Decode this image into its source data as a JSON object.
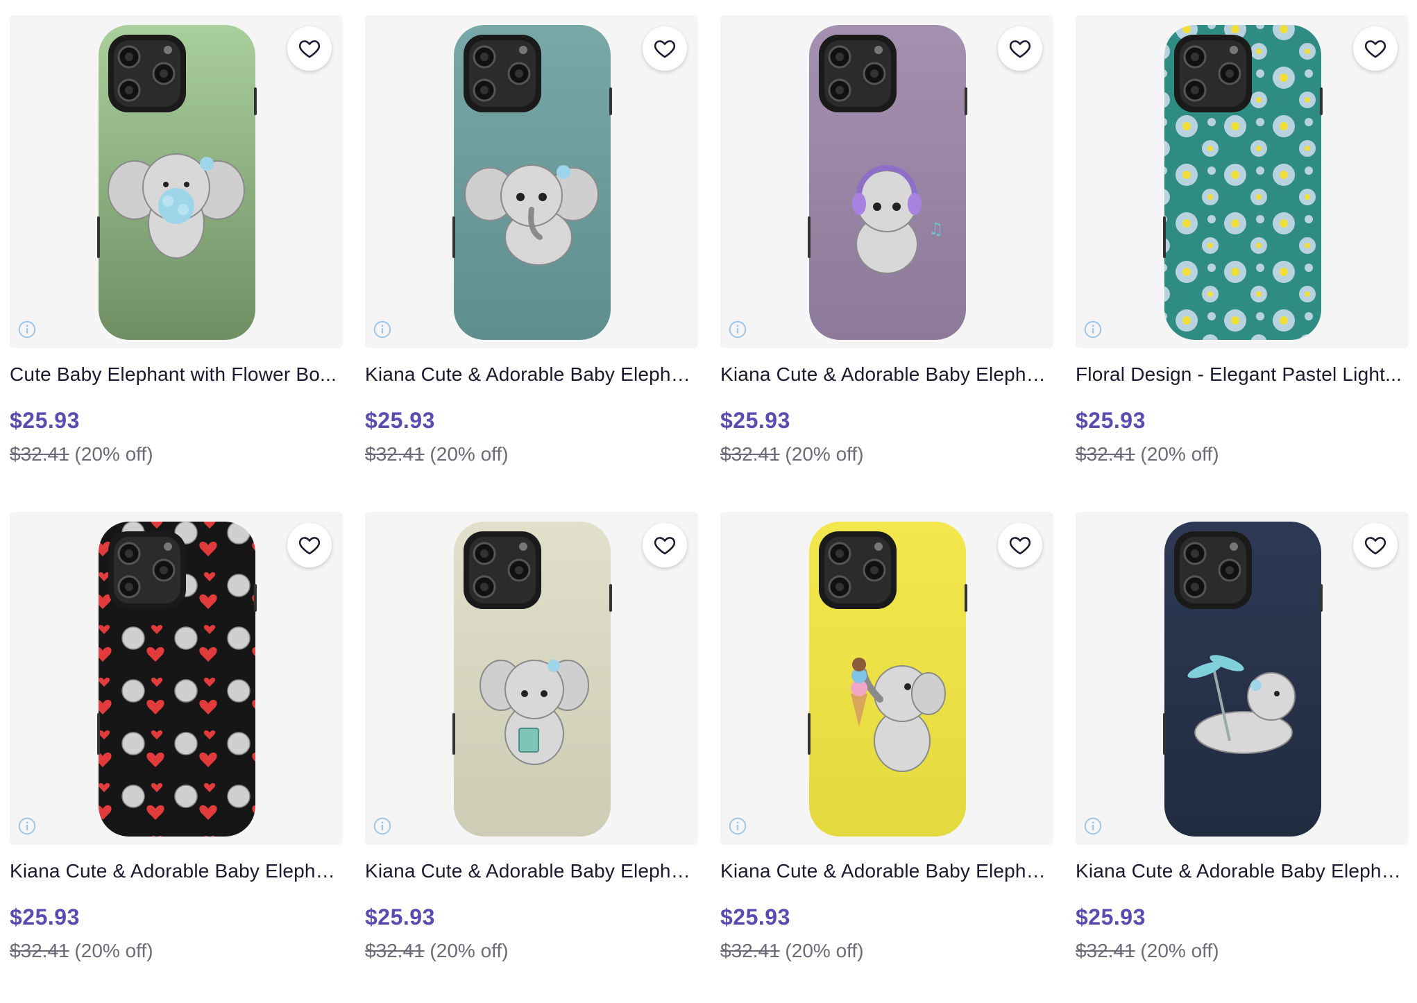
{
  "colors": {
    "price": "#5b4bb0",
    "title": "#1a1a2e",
    "muted": "#6b6b78",
    "card_bg": "#f5f5f6"
  },
  "products": [
    {
      "title": "Cute Baby Elephant with Flower Bo...",
      "price": "$25.93",
      "original_price": "$32.41",
      "discount": "(20% off)",
      "case_color": "#86a97a",
      "design": "elephant with flower bouquet",
      "favorite_icon": "heart-outline-icon",
      "info_icon": "info-icon"
    },
    {
      "title": "Kiana Cute & Adorable Baby Elepha...",
      "price": "$25.93",
      "original_price": "$32.41",
      "discount": "(20% off)",
      "case_color": "#6f9c9c",
      "design": "elephant walking",
      "favorite_icon": "heart-outline-icon",
      "info_icon": "info-icon"
    },
    {
      "title": "Kiana Cute & Adorable Baby Elepha...",
      "price": "$25.93",
      "original_price": "$32.41",
      "discount": "(20% off)",
      "case_color": "#9a84a6",
      "design": "elephant with headphones",
      "favorite_icon": "heart-outline-icon",
      "info_icon": "info-icon"
    },
    {
      "title": "Floral Design - Elegant Pastel Light...",
      "price": "$25.93",
      "original_price": "$32.41",
      "discount": "(20% off)",
      "case_color": "#2f8c82",
      "design": "pastel floral pattern",
      "favorite_icon": "heart-outline-icon",
      "info_icon": "info-icon"
    },
    {
      "title": "Kiana Cute & Adorable Baby Elepha...",
      "price": "$25.93",
      "original_price": "$32.41",
      "discount": "(20% off)",
      "case_color": "#161616",
      "design": "elephants and red hearts pattern",
      "favorite_icon": "heart-outline-icon",
      "info_icon": "info-icon"
    },
    {
      "title": "Kiana Cute & Adorable Baby Elepha...",
      "price": "$25.93",
      "original_price": "$32.41",
      "discount": "(20% off)",
      "case_color": "#d9d9c2",
      "design": "elephant reading a book",
      "favorite_icon": "heart-outline-icon",
      "info_icon": "info-icon"
    },
    {
      "title": "Kiana Cute & Adorable Baby Elepha...",
      "price": "$25.93",
      "original_price": "$32.41",
      "discount": "(20% off)",
      "case_color": "#ece24a",
      "design": "elephant with ice cream cone",
      "favorite_icon": "heart-outline-icon",
      "info_icon": "info-icon"
    },
    {
      "title": "Kiana Cute & Adorable Baby Elepha...",
      "price": "$25.93",
      "original_price": "$32.41",
      "discount": "(20% off)",
      "case_color": "#27334b",
      "design": "elephant with propeller",
      "favorite_icon": "heart-outline-icon",
      "info_icon": "info-icon"
    }
  ]
}
